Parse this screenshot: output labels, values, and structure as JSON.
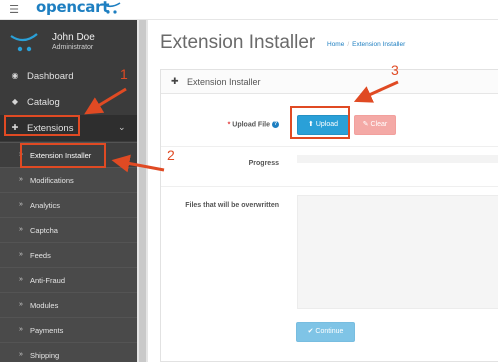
{
  "header": {
    "logo_text": "opencart"
  },
  "user": {
    "name": "John Doe",
    "role": "Administrator"
  },
  "sidebar": {
    "items": [
      {
        "label": "Dashboard",
        "icon": "dashboard-icon"
      },
      {
        "label": "Catalog",
        "icon": "tag-icon"
      },
      {
        "label": "Extensions",
        "icon": "puzzle-icon",
        "expanded": true
      }
    ],
    "subitems": [
      {
        "label": "Extension Installer",
        "active": true
      },
      {
        "label": "Modifications"
      },
      {
        "label": "Analytics"
      },
      {
        "label": "Captcha"
      },
      {
        "label": "Feeds"
      },
      {
        "label": "Anti-Fraud"
      },
      {
        "label": "Modules"
      },
      {
        "label": "Payments"
      },
      {
        "label": "Shipping"
      }
    ]
  },
  "page": {
    "title": "Extension Installer",
    "breadcrumb": [
      "Home",
      "Extension Installer"
    ]
  },
  "panel": {
    "title": "Extension Installer",
    "upload_label": "Upload File",
    "upload_button": "Upload",
    "clear_button": "Clear",
    "progress_label": "Progress",
    "files_label": "Files that will be overwritten",
    "continue_button": "Continue"
  },
  "annotations": {
    "markers": [
      "1",
      "2",
      "3"
    ],
    "color": "#e04a23"
  },
  "colors": {
    "brand": "#1e7fc1",
    "sidebar": "#3b3b3b",
    "upload": "#2aa0d8",
    "clear": "#f4a9a6",
    "continue": "#7fc4e6"
  }
}
